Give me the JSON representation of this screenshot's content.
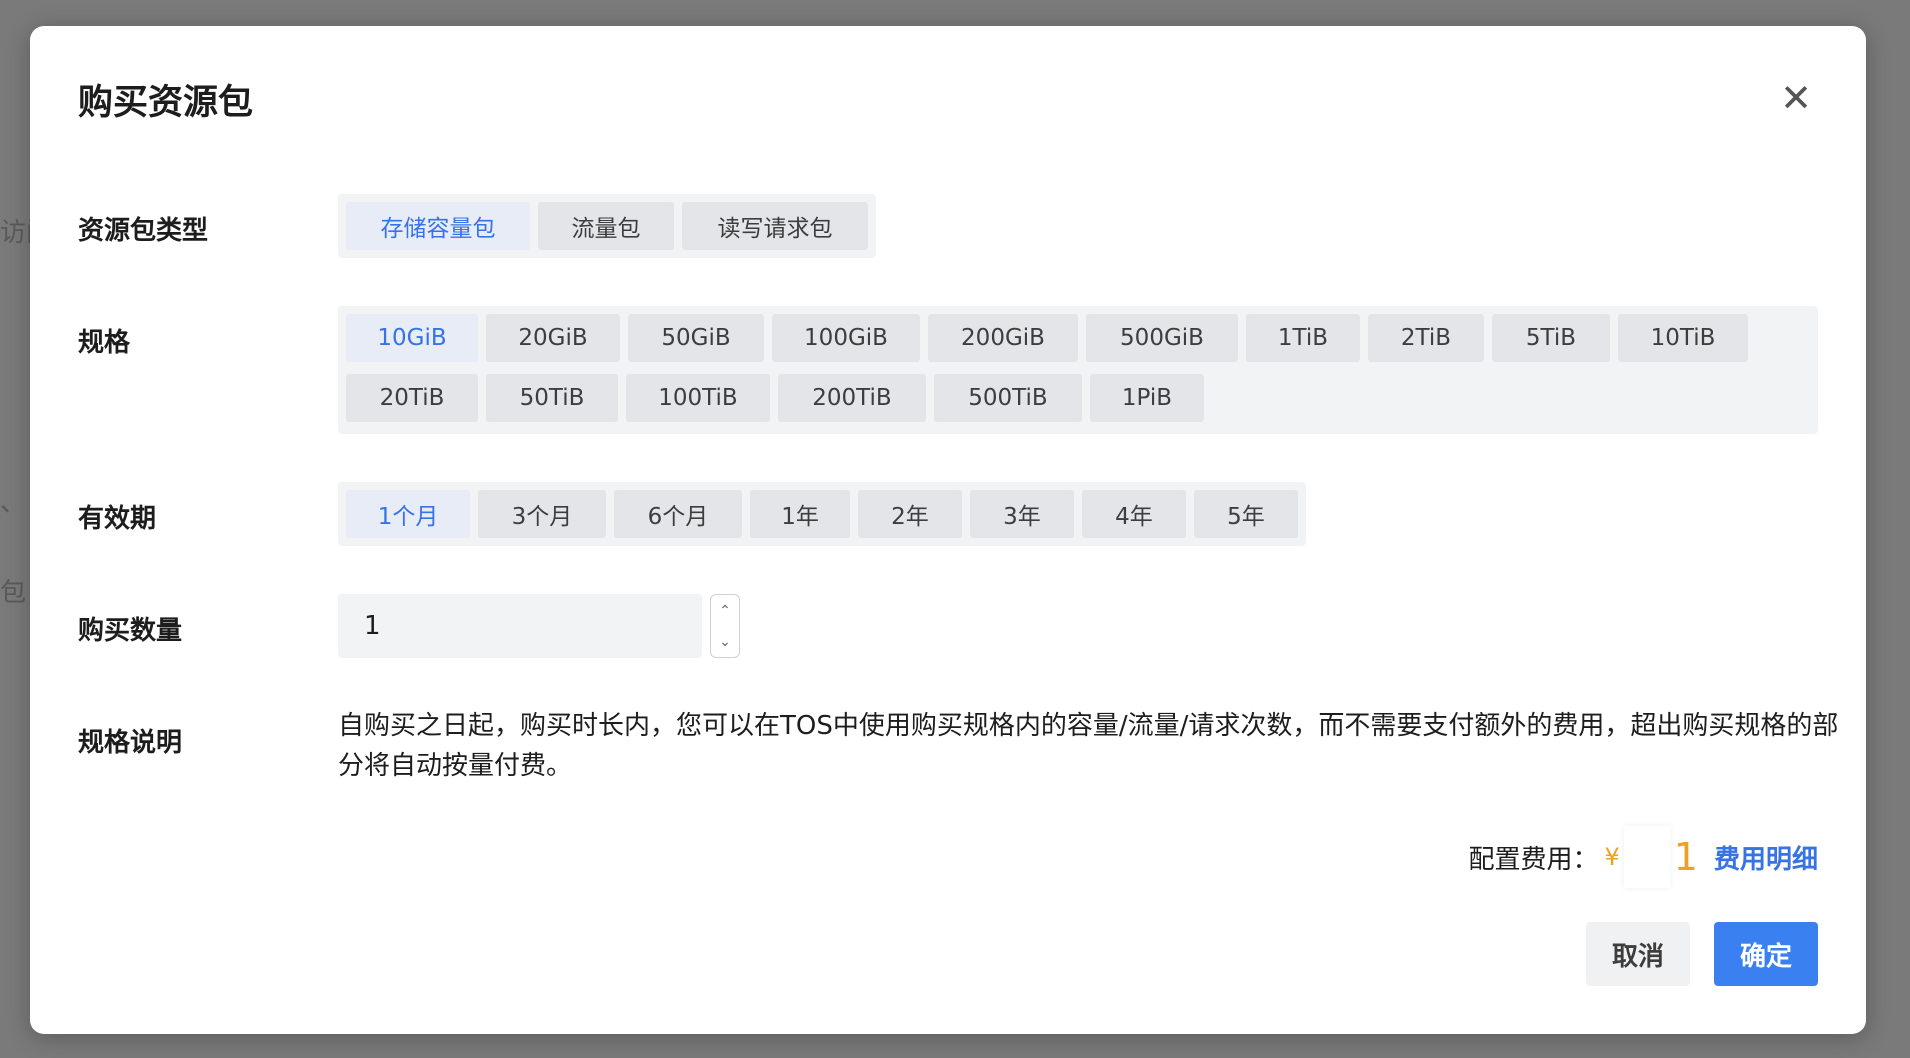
{
  "background": {
    "fragments": [
      "访问",
      "、",
      "包"
    ]
  },
  "dialog": {
    "title": "购买资源包",
    "close_icon": "close-icon"
  },
  "package_type": {
    "label": "资源包类型",
    "options": [
      "存储容量包",
      "流量包",
      "读写请求包"
    ],
    "selected": "存储容量包"
  },
  "spec": {
    "label": "规格",
    "options": [
      "10GiB",
      "20GiB",
      "50GiB",
      "100GiB",
      "200GiB",
      "500GiB",
      "1TiB",
      "2TiB",
      "5TiB",
      "10TiB",
      "20TiB",
      "50TiB",
      "100TiB",
      "200TiB",
      "500TiB",
      "1PiB"
    ],
    "selected": "10GiB"
  },
  "validity": {
    "label": "有效期",
    "options": [
      "1个月",
      "3个月",
      "6个月",
      "1年",
      "2年",
      "3年",
      "4年",
      "5年"
    ],
    "selected": "1个月"
  },
  "quantity": {
    "label": "购买数量",
    "value": "1",
    "up_icon": "chevron-up-icon",
    "down_icon": "chevron-down-icon"
  },
  "spec_desc": {
    "label": "规格说明",
    "text": "自购买之日起，购买时长内，您可以在TOS中使用购买规格内的容量/流量/请求次数，而不需要支付额外的费用，超出购买规格的部分将自动按量付费。"
  },
  "fee": {
    "label": "配置费用：",
    "currency": "¥",
    "amount_visible": "1",
    "detail_link": "费用明细"
  },
  "actions": {
    "cancel": "取消",
    "confirm": "确定"
  },
  "colors": {
    "accent": "#3573e6",
    "primary_button": "#3a80f0",
    "price": "#f0a020"
  }
}
